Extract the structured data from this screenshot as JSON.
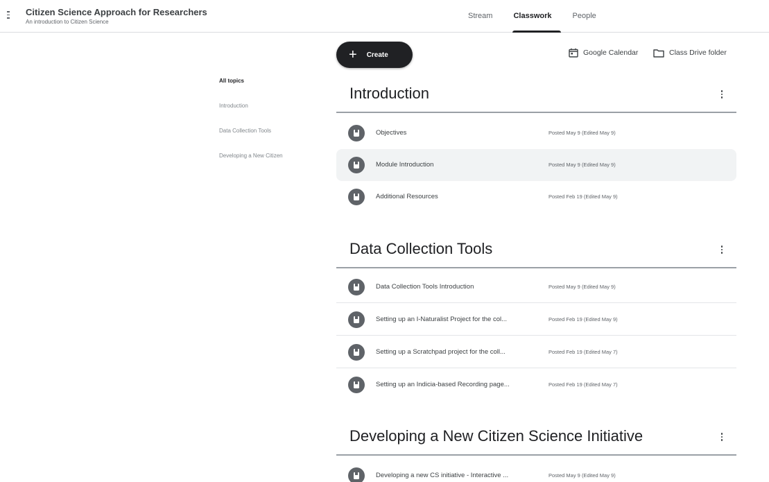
{
  "header": {
    "menu_icon": "menu-icon",
    "class_title": "Citizen Science Approach for Researchers",
    "class_subtitle": "An introduction to Citizen Science",
    "tabs": [
      {
        "label": "Stream",
        "active": false
      },
      {
        "label": "Classwork",
        "active": true
      },
      {
        "label": "People",
        "active": false
      }
    ]
  },
  "toolbar": {
    "create_label": "Create",
    "create_icon": "plus-icon",
    "calendar_label": "Google Calendar",
    "calendar_icon": "calendar-icon",
    "drive_label": "Class Drive folder",
    "drive_icon": "folder-icon"
  },
  "topic_nav": {
    "items": [
      "All topics",
      "Introduction",
      "Data Collection Tools",
      "Developing a New Citizen"
    ]
  },
  "topics": [
    {
      "title": "Introduction",
      "menu_icon": "more-vert-icon",
      "items": [
        {
          "title": "Objectives",
          "date": "Posted May 9 (Edited May 9)",
          "icon": "material-icon"
        },
        {
          "title": "Module Introduction",
          "date": "Posted May 9 (Edited May 9)",
          "icon": "material-icon"
        },
        {
          "title": "Additional Resources",
          "date": "Posted Feb 19 (Edited May 9)",
          "icon": "material-icon"
        }
      ]
    },
    {
      "title": "Data Collection Tools",
      "menu_icon": "more-vert-icon",
      "items": [
        {
          "title": "Data Collection Tools Introduction",
          "date": "Posted May 9 (Edited May 9)",
          "icon": "material-icon"
        },
        {
          "title": "Setting up an I-Naturalist Project for the col...",
          "date": "Posted Feb 19 (Edited May 9)",
          "icon": "material-icon"
        },
        {
          "title": "Setting up a Scratchpad project for the coll...",
          "date": "Posted Feb 19 (Edited May 7)",
          "icon": "material-icon"
        },
        {
          "title": "Setting up an Indicia-based Recording page...",
          "date": "Posted Feb 19 (Edited May 7)",
          "icon": "material-icon"
        }
      ]
    },
    {
      "title": "Developing a New Citizen Science Initiative",
      "menu_icon": "more-vert-icon",
      "items": [
        {
          "title": "Developing a new CS initiative - Interactive ...",
          "date": "Posted May 9 (Edited May 9)",
          "icon": "material-icon"
        }
      ]
    }
  ],
  "colors": {
    "accent": "#202124",
    "icon_circle": "#5f6368",
    "highlight_row": "#f1f3f4",
    "divider": "#dadce0"
  }
}
